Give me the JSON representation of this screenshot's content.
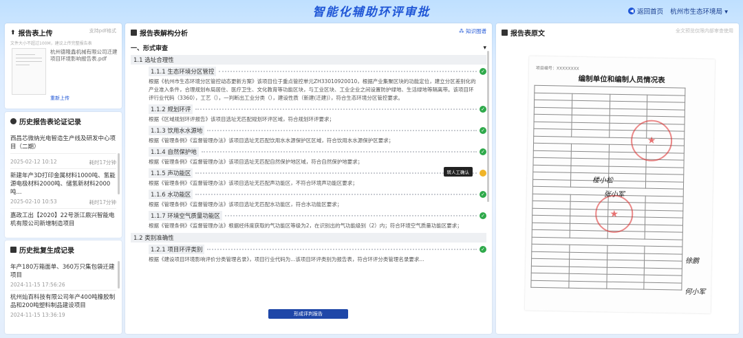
{
  "header": {
    "title": "智能化辅助环评审批",
    "back_label": "返回首页",
    "org": "杭州市生态环境局",
    "org_arrow": "▾"
  },
  "upload": {
    "title": "报告表上传",
    "support_hint": "支持pdf格式",
    "sub_hint": "文件大小不超过100M，建议上传完整报告表",
    "file_name": "杭州德隆鑫机械有限公司迁建项目环境影响报告表.pdf",
    "reupload_label": "重新上传"
  },
  "history_eval": {
    "title": "历史报告表论证记录",
    "items": [
      {
        "name": "西昌芯微纳光电智造生产线及研发中心项目（二期）",
        "date": "",
        "duration": ""
      },
      {
        "name": "",
        "date": "2025-02-12 10:12",
        "duration": "耗时17分钟"
      },
      {
        "name": "新建年产3D打印金属材料1000吨、氢能源电极材料2000吨、储氢新材料2000吨...",
        "date": "2025-02-10 10:53",
        "duration": "耗时17分钟"
      },
      {
        "name": "嘉政工出【2020】22号浙江鼎兴智能电机有限公司新增制造项目",
        "date": "",
        "duration": ""
      }
    ]
  },
  "history_approval": {
    "title": "历史批复生成记录",
    "items": [
      {
        "name": "年产180万箱面单、360万只集包袋迁建项目",
        "date": "2024-11-15 17:56:26"
      },
      {
        "name": "杭州灿百科技有限公司年产400吨橡胶制品和200吨塑料制品建设项目",
        "date": "2024-11-15 13:36:19"
      }
    ]
  },
  "analysis": {
    "title": "报告表解构分析",
    "top_link": "知识图谱",
    "section": "一、形式审查",
    "section_arrow": "▾",
    "group1": "1.1 选址合理性",
    "items": [
      {
        "label": "1.1.1 生态环境分区管控",
        "status": "ok",
        "text": "根据《杭州市生态环境分区管控动态更新方案》该项目位于重点管控单元ZH33010920010，根据产业集聚区块的功能定位，建立分区差别化的产业准入条件，合理规划布局居住、医疗卫生、文化教育等功能区块，与工业区块、工业企业之间设置防护绿地、生活绿地等隔离带。该项目环评行业代码（3360），工艺（），一判断出工业分类（），建设性质（新建(迁建)），符合生态环境分区管控要求。"
      },
      {
        "label": "1.1.2 规划环评",
        "status": "ok",
        "text": "根据《区域规划环评报告》该项目选址无匹配规划环评区域，符合规划环评要求；"
      },
      {
        "label": "1.1.3 饮用水水源地",
        "status": "ok",
        "text": "根据《管理条例》《监督管理办法》该项目选址无匹配饮用水水源保护区区域，符合饮用水水源保护区要求；"
      },
      {
        "label": "1.1.4 自然保护地",
        "status": "ok",
        "text": "根据《管理条例》《监督管理办法》该项目选址无匹配自然保护地区域，符合自然保护地要求；"
      },
      {
        "label": "1.1.5 声功能区",
        "status": "warn",
        "tag": "转人工确认",
        "text": "根据《管理条例》《监督管理办法》该项目选址无匹配声功能区，不符合环境声功能区要求；"
      },
      {
        "label": "1.1.6 水功能区",
        "status": "ok",
        "text": "根据《管理条例》《监督管理办法》该项目选址无匹配水功能区，符合水功能区要求；"
      },
      {
        "label": "1.1.7 环境空气质量功能区",
        "status": "ok",
        "text": "根据《管理条例》《监督管理办法》根据经纬度获取的气功能区等级为2，在识别出的气功能级别（2）内；符合环境空气质量功能区要求；"
      }
    ],
    "group2": "1.2 类别准确性",
    "sub_item": {
      "label": "1.2.1 项目环评类别",
      "status": "ok",
      "text": "根据《建设项目环境影响评价分类管理名录》，项目行业代码为...该项目环评类别为报告表，符合环评分类管理名录要求..."
    },
    "generate_button": "形成评判报告"
  },
  "original": {
    "title": "报告表原文",
    "hint": "全文预览仅限内部审查使用",
    "page_no": "项目编号：XXXXXXXX",
    "doc_title": "编制单位和编制人员情况表",
    "sign1": "楼小松",
    "sign2": "张小军",
    "sign3": "徐鹏",
    "sign4": "何小军"
  }
}
